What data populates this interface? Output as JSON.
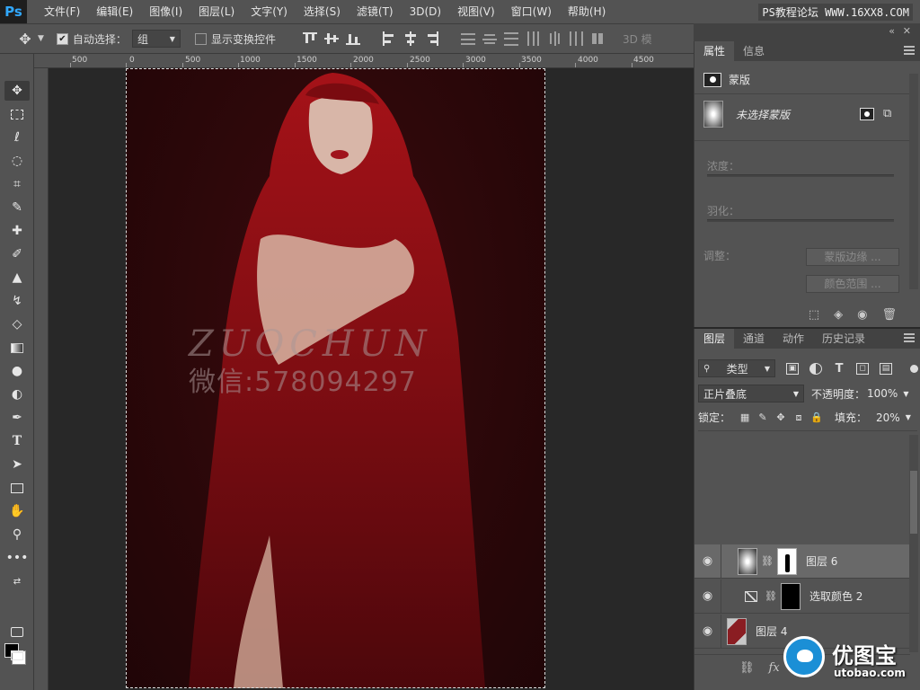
{
  "app": {
    "logo": "Ps",
    "site_tag": "PS教程论坛 WWW.16XX8.COM"
  },
  "menu": [
    "文件(F)",
    "编辑(E)",
    "图像(I)",
    "图层(L)",
    "文字(Y)",
    "选择(S)",
    "滤镜(T)",
    "3D(D)",
    "视图(V)",
    "窗口(W)",
    "帮助(H)"
  ],
  "options": {
    "auto_select_label": "自动选择：",
    "auto_select_value": "组",
    "show_transform_label": "显示变换控件",
    "three_d_label": "3D 模"
  },
  "ruler": {
    "ticks": [
      "500",
      "0",
      "500",
      "1000",
      "1500",
      "2000",
      "2500",
      "3000",
      "3500",
      "4000",
      "4500"
    ]
  },
  "canvas": {
    "watermark_en": "ZUOCHUN",
    "watermark_cn": "微信:578094297"
  },
  "properties": {
    "tabs": [
      "属性",
      "信息"
    ],
    "mask_label": "蒙版",
    "no_mask_selected": "未选择蒙版",
    "density_label": "浓度：",
    "feather_label": "羽化：",
    "adjust_label": "调整：",
    "mask_edge_button": "蒙版边缘 ...",
    "color_range_button": "颜色范围 ..."
  },
  "layers": {
    "tabs": [
      "图层",
      "通道",
      "动作",
      "历史记录"
    ],
    "filter_kind": "类型",
    "blend_mode": "正片叠底",
    "opacity_label": "不透明度：",
    "opacity_value": "100%",
    "lock_label": "锁定：",
    "fill_label": "填充：",
    "fill_value": "20%",
    "items": [
      {
        "name": "图层 6",
        "selected": true
      },
      {
        "name": "选取颜色 2",
        "selected": false
      },
      {
        "name": "图层 4",
        "selected": false
      }
    ],
    "footer_fx": "fx"
  },
  "brand": {
    "name_cn": "优图宝",
    "url": "utobao.com"
  }
}
